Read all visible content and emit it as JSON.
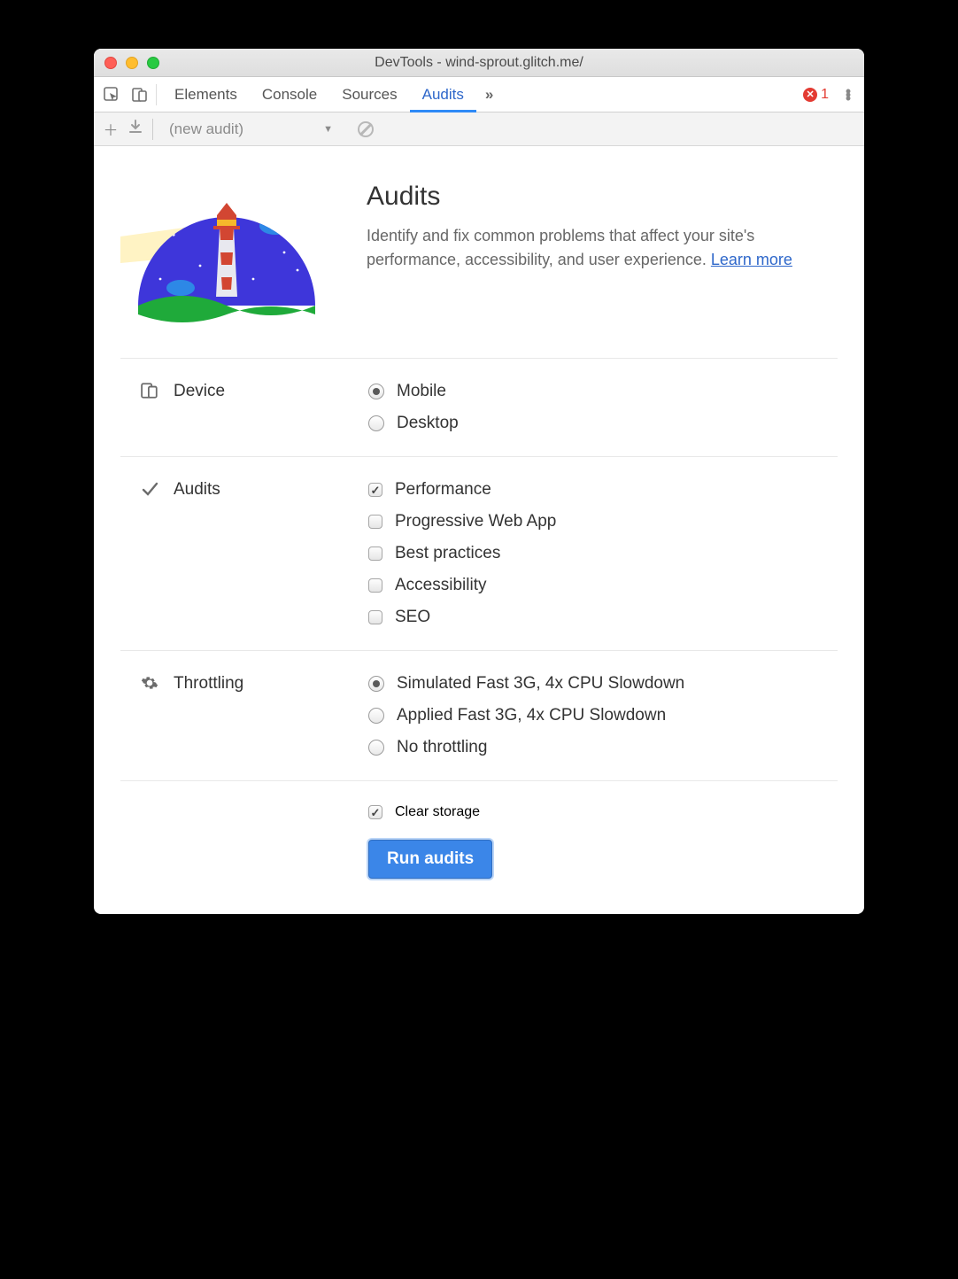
{
  "window": {
    "title": "DevTools - wind-sprout.glitch.me/"
  },
  "tabs": {
    "items": [
      "Elements",
      "Console",
      "Sources",
      "Audits"
    ],
    "active": "Audits",
    "more_glyph": "»",
    "error_count": "1"
  },
  "subbar": {
    "dropdown_label": "(new audit)",
    "dropdown_caret": "▼"
  },
  "header": {
    "title": "Audits",
    "desc_before": "Identify and fix common problems that affect your site's performance, accessibility, and user experience. ",
    "learn_more": "Learn more"
  },
  "device": {
    "label": "Device",
    "options": [
      {
        "label": "Mobile",
        "checked": true
      },
      {
        "label": "Desktop",
        "checked": false
      }
    ]
  },
  "audits": {
    "label": "Audits",
    "options": [
      {
        "label": "Performance",
        "checked": true
      },
      {
        "label": "Progressive Web App",
        "checked": false
      },
      {
        "label": "Best practices",
        "checked": false
      },
      {
        "label": "Accessibility",
        "checked": false
      },
      {
        "label": "SEO",
        "checked": false
      }
    ]
  },
  "throttling": {
    "label": "Throttling",
    "options": [
      {
        "label": "Simulated Fast 3G, 4x CPU Slowdown",
        "checked": true
      },
      {
        "label": "Applied Fast 3G, 4x CPU Slowdown",
        "checked": false
      },
      {
        "label": "No throttling",
        "checked": false
      }
    ]
  },
  "clear_storage": {
    "label": "Clear storage",
    "checked": true
  },
  "run_button": "Run audits"
}
